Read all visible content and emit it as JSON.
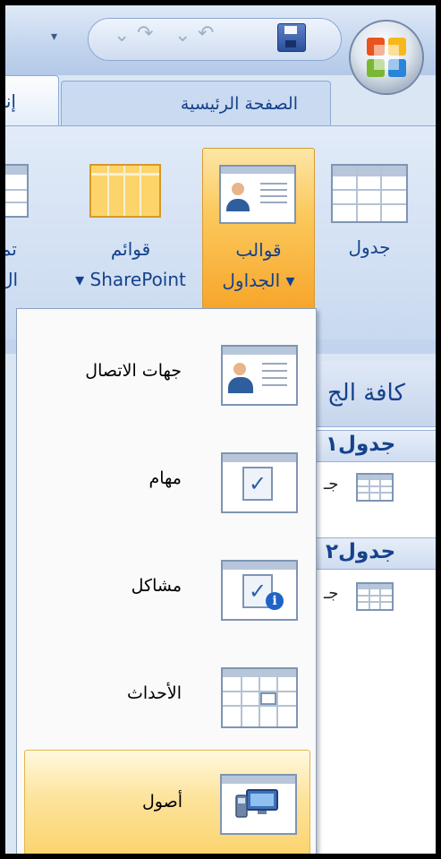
{
  "ribbon_tabs": {
    "home": "الصفحة الرئيسية",
    "insert_partial": "إنـ"
  },
  "ribbon_buttons": {
    "table": "جدول",
    "table_templates_line1": "قوالب",
    "table_templates_line2": "الجداول ▾",
    "sharepoint_line1": "قوائم",
    "sharepoint_line2": "▾ SharePoint",
    "cut_line1": "تم",
    "cut_line2": "ال"
  },
  "menu": {
    "items": [
      {
        "label": "جهات الاتصال",
        "icon": "contact-card-icon"
      },
      {
        "label": "مهام",
        "icon": "task-clipboard-icon"
      },
      {
        "label": "مشاكل",
        "icon": "issue-clipboard-icon"
      },
      {
        "label": "الأحداث",
        "icon": "calendar-grid-icon"
      },
      {
        "label": "أصول",
        "icon": "asset-computer-icon"
      }
    ],
    "highlighted_index": 4
  },
  "nav_pane": {
    "header": "كافة الج",
    "groups": [
      {
        "label": "جدول١",
        "item": "جـ"
      },
      {
        "label": "جدول٢",
        "item": "جـ"
      }
    ]
  },
  "colors": {
    "ribbon_text": "#15428b",
    "highlight": "#fbc95d"
  }
}
